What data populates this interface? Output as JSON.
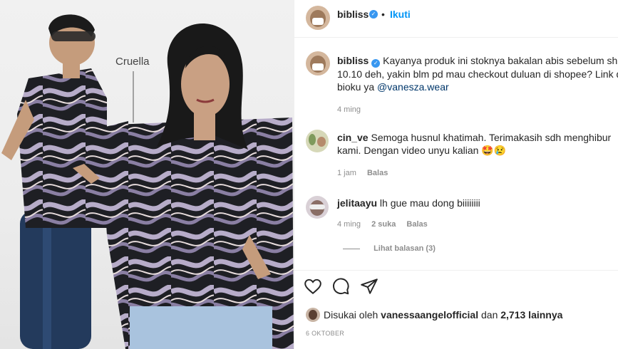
{
  "photo": {
    "label": "Cruella"
  },
  "header": {
    "username": "bibliss",
    "dot": "•",
    "follow": "Ikuti"
  },
  "post": {
    "username": "bibliss",
    "caption_lines": [
      "Kayanya produk ini stoknya bakalan abis sebelum sho",
      "10.10 deh, yakin blm pd mau checkout duluan di shopee? Link d",
      "bioku ya"
    ],
    "mention": "@vanesza.wear",
    "time": "4 ming"
  },
  "comments": [
    {
      "username": "cin_ve",
      "text_line1": "Semoga husnul khatimah. Terimakasih sdh menghibur",
      "text_line2": "kami. Dengan video unyu kalian 🤩😢",
      "time": "1 jam",
      "reply": "Balas"
    },
    {
      "username": "jelitaayu",
      "text_line1": "lh gue mau dong biiiiiiii",
      "time": "4 ming",
      "likes": "2 suka",
      "reply": "Balas",
      "view_replies": "Lihat balasan (3)"
    }
  ],
  "likes": {
    "prefix": "Disukai oleh",
    "user": "vanessaangelofficial",
    "mid": "dan",
    "count": "2,713 lainnya"
  },
  "date": "6 OKTOBER"
}
